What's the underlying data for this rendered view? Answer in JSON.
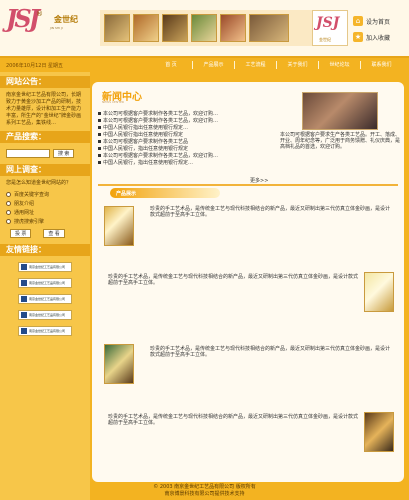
{
  "header": {
    "logo_mark": "JSJ",
    "logo_reg": "®",
    "logo_cn": "金世纪",
    "logo_en": "JIN SHI JI",
    "logo2_mark": "JSJ",
    "logo2_text": "金世纪",
    "quick_links": [
      {
        "label": "设为首页",
        "icon": "home-icon"
      },
      {
        "label": "加入收藏",
        "icon": "star-icon"
      }
    ]
  },
  "nav": {
    "date": "2006年10月12日 星期五",
    "items": [
      "首 页",
      "产品展示",
      "工艺流程",
      "关于我们",
      "世纪论坛",
      "联系我们"
    ]
  },
  "sidebar": {
    "notice_title": "网站公告：",
    "notice_text": "南京金世纪工艺品有限公司，长期致力于黄金沙加工产品的研制，技术力量雄厚，设计和加工生产能力丰富，所生产的“金世纪”牌金砂画系列工艺品，集铁线…",
    "search_title": "产品搜索：",
    "search_button": "搜 索",
    "survey_title": "网上调查：",
    "survey_question": "您是怎么知道金世纪网站的？",
    "survey_options": [
      "百度关键字查询",
      "朋友介绍",
      "通用网址",
      "搜虎搜索引擎"
    ],
    "vote_button": "投 票",
    "view_button": "查 看",
    "links_title": "友情链接：",
    "link_items": [
      "南京金世纪工艺品有限公司",
      "南京金世纪工艺品有限公司",
      "南京金世纪工艺品有限公司",
      "南京金世纪工艺品有限公司",
      "南京金世纪工艺品有限公司"
    ]
  },
  "main": {
    "news_title": "新闻中心",
    "news_sub": "NEWS CENTER",
    "news_items": [
      "本公司可根据客户要求制作各类工艺品，欢迎订购…",
      "本公司可根据客户要求制作各类工艺品，欢迎订购…",
      "中国人民银行指出任意使用银行规定…",
      "中国人民银行指出任意使用银行规定",
      "本公司可根据客户要求制作各类工艺品",
      "中国人民银行，指出任意使用银行规定",
      "本公司可根据客户要求制作各类工艺品，欢迎订购…",
      "中国人民银行，指出任意使用银行规定…"
    ],
    "more": "更多>>",
    "intro_text": "本公司可根据客户要求生产各类工艺品。开工、落成、开业、周年纪念等，广泛用于商务馈赠、礼仪庆典，是高档礼品的首选，欢迎订购。",
    "product_banner": "产品展示",
    "product_text_1": "珍贵的手工艺术品，是传统金工艺与现代科技相结合的新产品，最近又研制出第三代仿真立体金砂画，是设计款式超前于至高手工立体。",
    "product_text_2": "珍贵的手工艺术品，是传统金工艺与现代科技相结合的新产品，最近又研制出第三代仿真立体金砂画，是设计款式超前于至高手工立体。",
    "product_text_3": "珍贵的手工艺术品，是传统金工艺与现代科技相结合的新产品，最近又研制出第三代仿真立体金砂画，是设计款式超前于至高手工立体。",
    "product_text_4": "珍贵的手工艺术品，是传统金工艺与现代科技相结合的新产品，最近又研制出第三代仿真立体金砂画，是设计款式超前于至高手工立体。"
  },
  "footer": {
    "line1": "© 2003  南京金世纪工艺品有限公司  版权所有",
    "line2": "南京博景科技有限公司提供技术支持"
  }
}
